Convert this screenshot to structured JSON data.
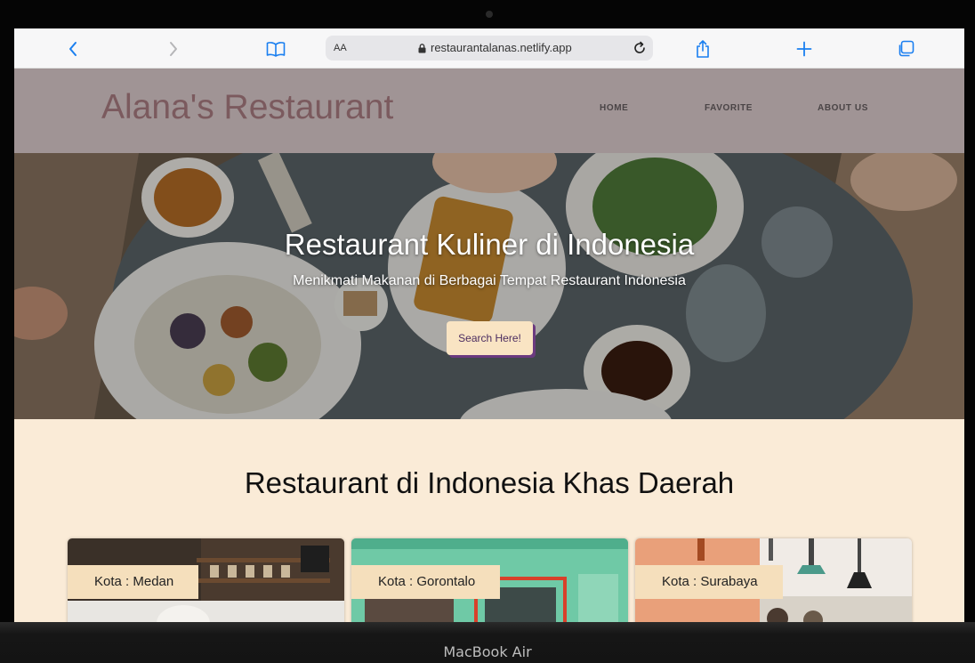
{
  "browser": {
    "text_size_label": "AA",
    "url": "restaurantalanas.netlify.app"
  },
  "site": {
    "brand": "Alana's Restaurant",
    "nav": [
      "HOME",
      "FAVORITE",
      "ABOUT US"
    ]
  },
  "hero": {
    "title": "Restaurant Kuliner di Indonesia",
    "subtitle": "Menikmati Makanan di Berbagai Tempat Restaurant Indonesia",
    "button_label": "Search Here!"
  },
  "section": {
    "title": "Restaurant di Indonesia Khas Daerah",
    "cards": [
      {
        "label": "Kota : Medan"
      },
      {
        "label": "Kota : Gorontalo"
      },
      {
        "label": "Kota : Surabaya"
      }
    ]
  },
  "device": {
    "label": "MacBook Air"
  },
  "colors": {
    "header_bg": "#a09495",
    "brand_text": "#7b5a5e",
    "section_bg": "#faebd7",
    "button_bg": "#f9e4c3",
    "button_shadow": "#6b3a7f",
    "card_label_bg": "#f5dfbc",
    "safari_accent": "#1a7ff0"
  },
  "icons": [
    "back-icon",
    "forward-icon",
    "bookmarks-icon",
    "lock-icon",
    "reload-icon",
    "share-icon",
    "new-tab-icon",
    "tabs-icon"
  ]
}
